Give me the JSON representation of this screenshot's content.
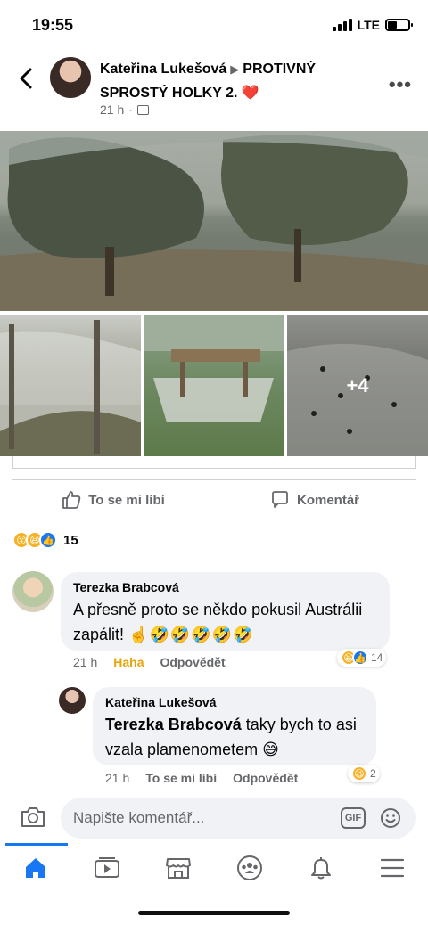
{
  "status_bar": {
    "time": "19:55",
    "network": "LTE",
    "signal_bars": 4,
    "battery_level": 0.45
  },
  "post": {
    "author": "Kateřina Lukešová",
    "separator_icon": "triangle-right-icon",
    "group": "PROTIVNÝ SPROSTÝ HOLKY 2.",
    "group_emoji": "❤️",
    "time": "21 h",
    "audience_icon": "group-icon",
    "extra_photos_label": "+4"
  },
  "actions": {
    "like_label": "To se mi líbí",
    "comment_label": "Komentář"
  },
  "reactions": {
    "count": "15",
    "types": [
      "wow",
      "haha",
      "like"
    ]
  },
  "comments": [
    {
      "name": "Terezka Brabcová",
      "text": "A přesně proto se někdo pokusil Austrálii zapálit!",
      "emoji": "☝️🤣🤣🤣🤣🤣",
      "time": "21 h",
      "reaction_label": "Haha",
      "reply_label": "Odpovědět",
      "reaction_count": "14"
    },
    {
      "name": "Kateřina Lukešová",
      "mention": "Terezka Brabcová",
      "text": "taky bych to asi vzala plamenometem",
      "emoji": "😅",
      "time": "21 h",
      "like_label": "To se mi líbí",
      "reply_label": "Odpovědět",
      "reaction_count": "2"
    }
  ],
  "composer": {
    "placeholder": "Napište komentář...",
    "gif_label": "GIF"
  },
  "nav": {
    "items": [
      "home-icon",
      "video-icon",
      "marketplace-icon",
      "groups-icon",
      "notifications-icon",
      "menu-icon"
    ],
    "active": "home-icon"
  },
  "colors": {
    "accent": "#1877f2",
    "secondary_text": "#65676b",
    "bubble": "#f0f2f5",
    "haha": "#e5a50a",
    "heart": "#e41e3f"
  }
}
